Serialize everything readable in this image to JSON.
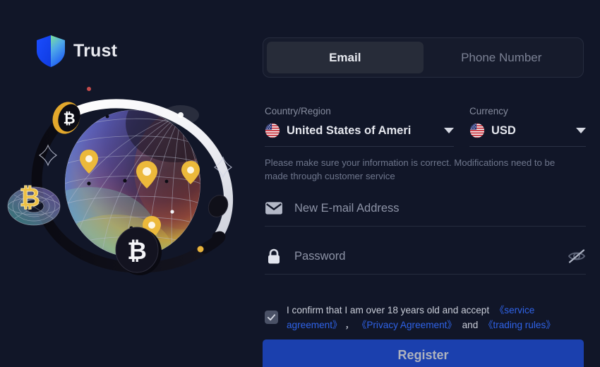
{
  "brand": {
    "name": "Trust",
    "logo_icon": "shield-icon"
  },
  "illustration": {
    "name": "crypto-globe-illustration",
    "elements": [
      "globe-wireframe",
      "orbit-ring",
      "bitcoin-coin-gold",
      "bitcoin-coin-black",
      "bitcoin-torus",
      "location-pins",
      "stars"
    ]
  },
  "tabs": [
    {
      "label": "Email",
      "active": true
    },
    {
      "label": "Phone Number",
      "active": false
    }
  ],
  "selectors": {
    "country": {
      "label": "Country/Region",
      "value": "United States of Ameri",
      "flag": "us-flag-icon"
    },
    "currency": {
      "label": "Currency",
      "value": "USD",
      "flag": "us-flag-icon"
    }
  },
  "notice": "Please make sure your information is correct. Modifications need to be made through customer service",
  "fields": {
    "email": {
      "placeholder": "New E-mail Address",
      "value": "",
      "icon": "envelope-icon"
    },
    "password": {
      "placeholder": "Password",
      "value": "",
      "icon": "lock-icon",
      "toggle_icon": "eye-off-icon"
    }
  },
  "agreement": {
    "checked": true,
    "text_before": "I confirm that I am over 18 years old and accept",
    "link_service": "《service agreement》",
    "separator": "，",
    "link_privacy": "《Privacy Agreement》",
    "conjunction": "and",
    "link_trading": "《trading rules》"
  },
  "register": {
    "label": "Register"
  },
  "colors": {
    "background": "#111628",
    "accent_blue": "#1b40ae",
    "link_blue": "#2f63e8",
    "tab_active_bg": "#272c39",
    "text_primary": "#e5e7ee",
    "text_muted": "#868c9e"
  }
}
